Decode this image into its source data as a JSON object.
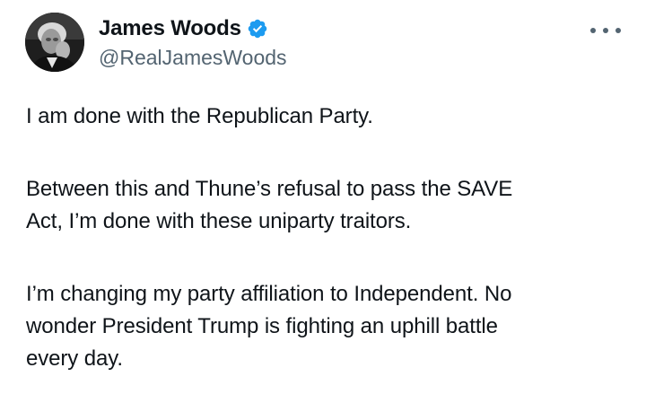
{
  "author": {
    "display_name": "James Woods",
    "handle": "@RealJamesWoods",
    "verified_icon": "verified-badge-icon",
    "avatar_icon": "avatar-photo"
  },
  "menu": {
    "more_icon": "more-options-icon"
  },
  "tweet": {
    "paragraph_1_line_1": "I am done with the Republican Party.",
    "paragraph_2_line_1": "Between this and Thune’s refusal to pass the SAVE",
    "paragraph_2_line_2": "Act, I’m done with these uniparty traitors.",
    "paragraph_3_line_1": "I’m changing my party affiliation to Independent. No",
    "paragraph_3_line_2": "wonder President Trump is fighting an uphill battle",
    "paragraph_3_line_3": "every day."
  },
  "colors": {
    "text": "#0f1419",
    "secondary": "#536471",
    "verified": "#1d9bf0"
  }
}
